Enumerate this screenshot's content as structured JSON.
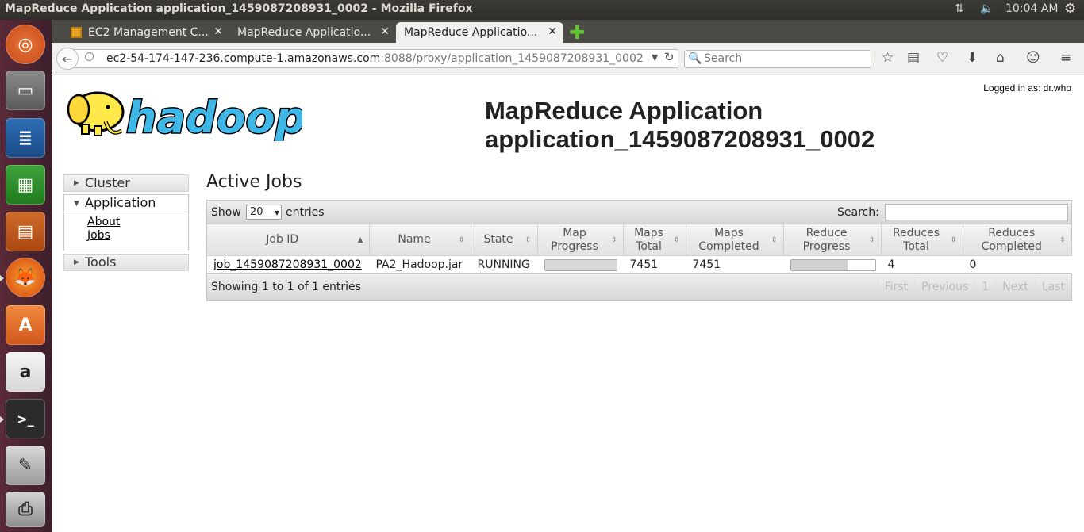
{
  "window": {
    "title": "MapReduce Application application_1459087208931_0002 - Mozilla Firefox",
    "clock": "10:04 AM"
  },
  "tabs": [
    {
      "label": "EC2 Management C...",
      "active": false
    },
    {
      "label": "MapReduce Applicatio...",
      "active": false
    },
    {
      "label": "MapReduce Applicatio...",
      "active": true
    }
  ],
  "address": {
    "host": "ec2-54-174-147-236.compute-1.amazonaws.com",
    "rest": ":8088/proxy/application_1459087208931_0002"
  },
  "search": {
    "placeholder": "Search"
  },
  "page": {
    "logged_in": "Logged in as: dr.who",
    "title": "MapReduce Application",
    "subtitle": "application_1459087208931_0002",
    "logo_text": "hadoop"
  },
  "nav": {
    "cluster": "Cluster",
    "application": "Application",
    "about": "About",
    "jobs": "Jobs",
    "tools": "Tools"
  },
  "jobs_section": {
    "heading": "Active Jobs",
    "show": "Show",
    "page_length": "20",
    "entries": "entries",
    "search_label": "Search:",
    "columns": [
      {
        "l1": "Job ID",
        "l2": ""
      },
      {
        "l1": "Name",
        "l2": ""
      },
      {
        "l1": "State",
        "l2": ""
      },
      {
        "l1": "Map",
        "l2": "Progress"
      },
      {
        "l1": "Maps",
        "l2": "Total"
      },
      {
        "l1": "Maps",
        "l2": "Completed"
      },
      {
        "l1": "Reduce",
        "l2": "Progress"
      },
      {
        "l1": "Reduces",
        "l2": "Total"
      },
      {
        "l1": "Reduces",
        "l2": "Completed"
      }
    ],
    "rows": [
      {
        "job_id": "job_1459087208931_0002",
        "name": "PA2_Hadoop.jar",
        "state": "RUNNING",
        "map_progress": 1.0,
        "maps_total": "7451",
        "maps_completed": "7451",
        "reduce_progress": 0.67,
        "reduces_total": "4",
        "reduces_completed": "0"
      }
    ],
    "info": "Showing 1 to 1 of 1 entries",
    "pager": {
      "first": "First",
      "previous": "Previous",
      "page": "1",
      "next": "Next",
      "last": "Last"
    }
  }
}
